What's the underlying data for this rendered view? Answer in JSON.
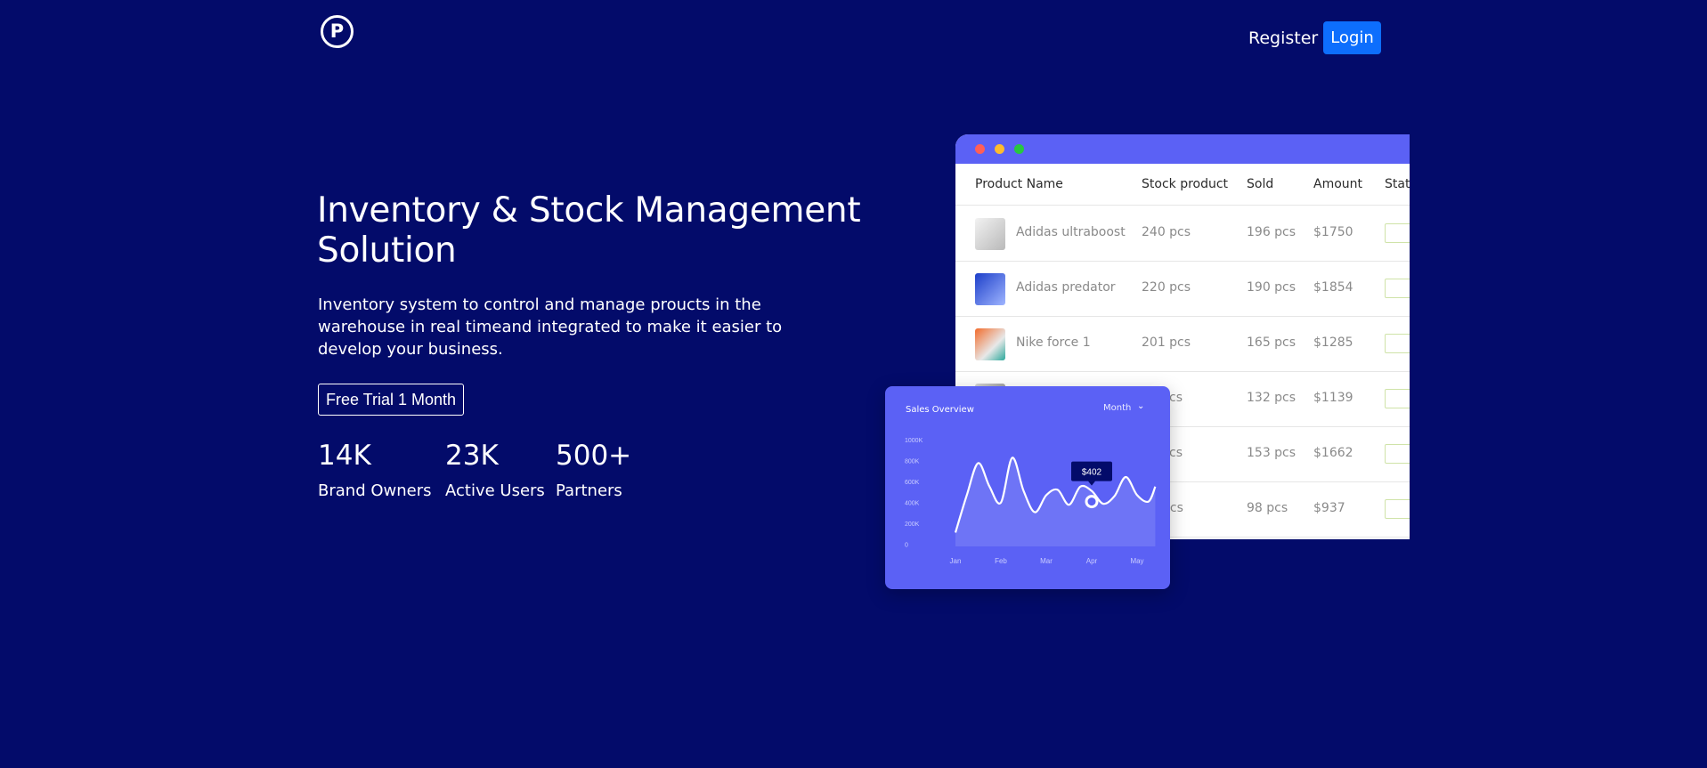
{
  "brand": {
    "logo_letter": "P",
    "logo_icon": "p-circle-logo-icon"
  },
  "nav": {
    "register_label": "Register",
    "login_label": "Login"
  },
  "hero": {
    "title": "Inventory & Stock Management Solution",
    "description": "Inventory system to control and manage proucts in the warehouse in real timeand integrated to make it easier to develop your business.",
    "cta_label": "Free Trial 1 Month"
  },
  "stats": [
    {
      "value": "14K",
      "label": "Brand Owners"
    },
    {
      "value": "23K",
      "label": "Active Users"
    },
    {
      "value": "500+",
      "label": "Partners"
    }
  ],
  "table": {
    "headers": [
      "Product Name",
      "Stock product",
      "Sold",
      "Amount",
      "Statu"
    ],
    "rows": [
      {
        "name": "Adidas ultraboost",
        "stock": "240 pcs",
        "sold": "196 pcs",
        "amount": "$1750"
      },
      {
        "name": "Adidas predator",
        "stock": "220 pcs",
        "sold": "190 pcs",
        "amount": "$1854"
      },
      {
        "name": "Nike force 1",
        "stock": "201 pcs",
        "sold": "165 pcs",
        "amount": "$1285"
      },
      {
        "name": "",
        "stock": "cs",
        "sold": "132 pcs",
        "amount": "$1139"
      },
      {
        "name": "",
        "stock": "cs",
        "sold": "153 pcs",
        "amount": "$1662"
      },
      {
        "name": "",
        "stock": "pcs",
        "sold": "98 pcs",
        "amount": "$937"
      }
    ]
  },
  "sales_card": {
    "title": "Sales Overview",
    "filter_label": "Month",
    "tooltip": "$402"
  },
  "chart_data": {
    "type": "line",
    "title": "Sales Overview",
    "x": [
      0,
      0.25,
      0.5,
      0.75,
      1,
      1.25,
      1.5,
      1.75,
      2,
      2.25,
      2.5,
      2.75,
      3,
      3.25,
      3.5,
      3.75,
      4,
      4.25,
      4.4
    ],
    "categories": [
      "Jan",
      "Feb",
      "Mar",
      "Apr",
      "May"
    ],
    "yticks": [
      "1000K",
      "800K",
      "600K",
      "400K",
      "200K",
      "0"
    ],
    "ylim": [
      0,
      1000
    ],
    "values": [
      130,
      480,
      780,
      560,
      410,
      830,
      520,
      320,
      480,
      530,
      390,
      560,
      520,
      400,
      470,
      650,
      480,
      420,
      560
    ],
    "highlight": {
      "x": 3,
      "value": 420,
      "label": "$402"
    },
    "colors": {
      "line": "#ffffff",
      "card": "#5b61f5",
      "tooltip": "#030b6a"
    }
  }
}
